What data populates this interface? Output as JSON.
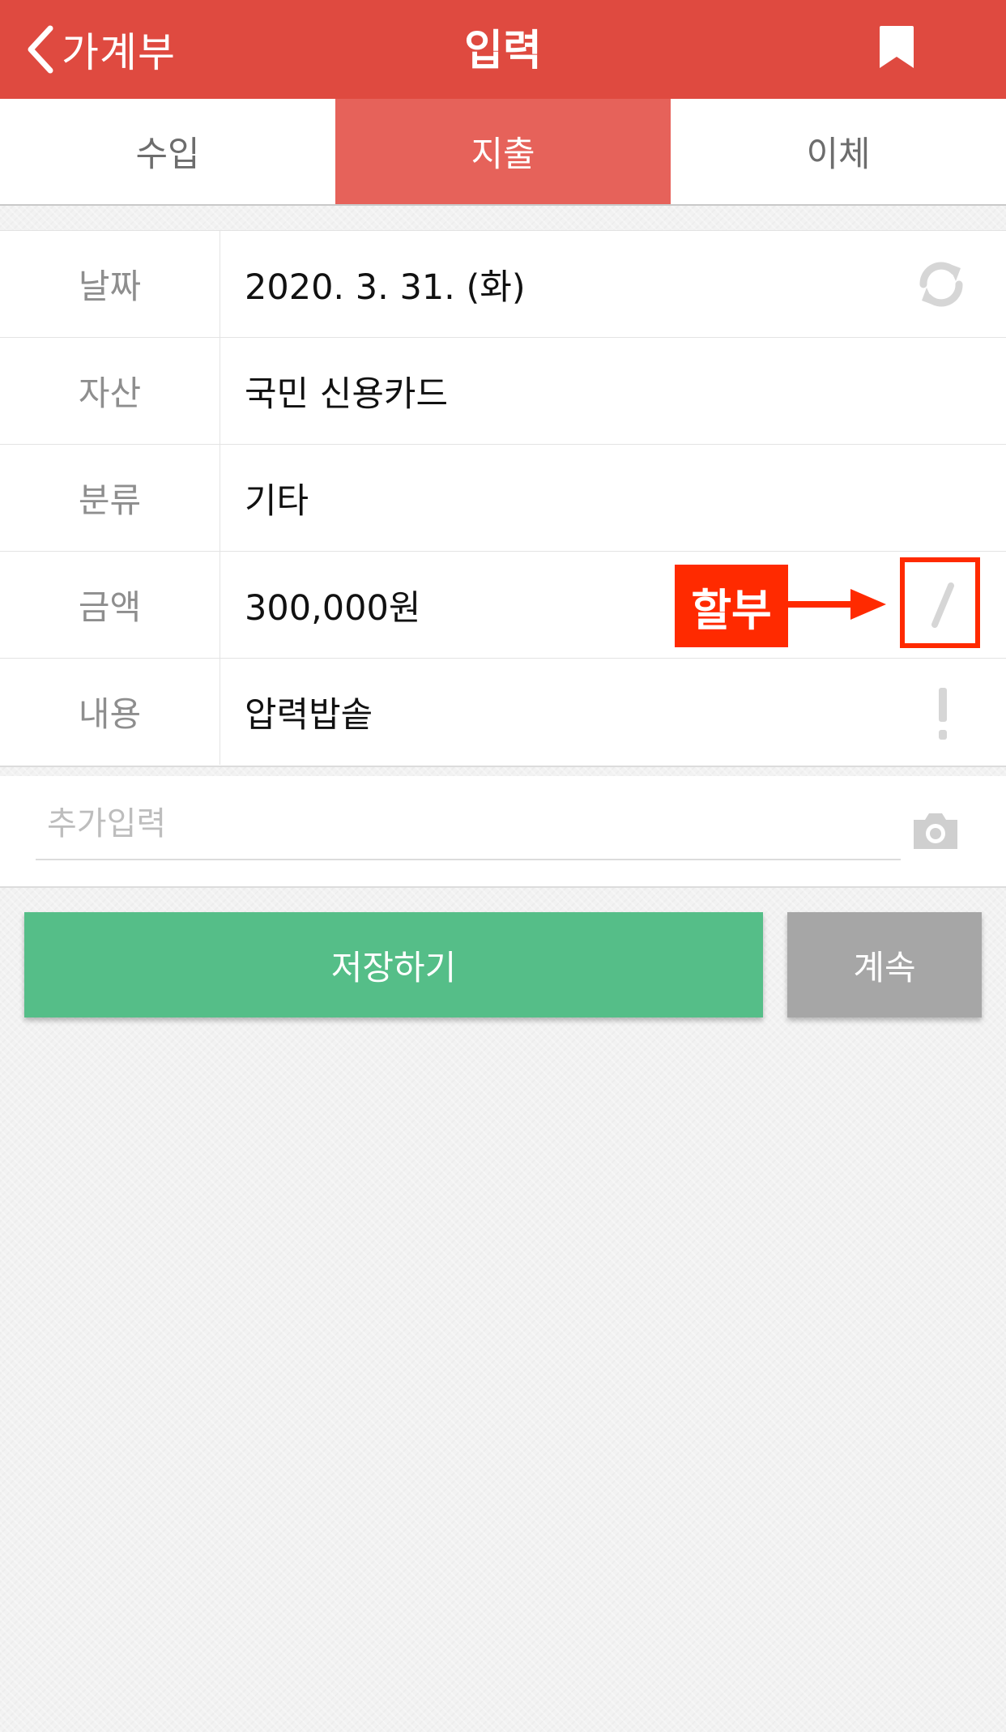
{
  "header": {
    "back_label": "가계부",
    "title": "입력"
  },
  "tabs": [
    {
      "label": "수입",
      "active": false
    },
    {
      "label": "지출",
      "active": true
    },
    {
      "label": "이체",
      "active": false
    }
  ],
  "form": {
    "date": {
      "label": "날짜",
      "value": "2020. 3. 31. (화)"
    },
    "asset": {
      "label": "자산",
      "value": "국민 신용카드"
    },
    "category": {
      "label": "분류",
      "value": "기타"
    },
    "amount": {
      "label": "금액",
      "value": "300,000원"
    },
    "memo": {
      "label": "내용",
      "value": "압력밥솥"
    }
  },
  "annotation": {
    "label": "할부",
    "color": "#ff2a00"
  },
  "extra": {
    "placeholder": "추가입력",
    "value": ""
  },
  "actions": {
    "save_label": "저장하기",
    "continue_label": "계속"
  },
  "colors": {
    "header": "#df4a40",
    "active_tab": "#e6625a",
    "save_button": "#55be88",
    "continue_button": "#a6a6a6"
  },
  "icons": [
    "chevron-left-icon",
    "bookmark-icon",
    "refresh-icon",
    "installment-icon",
    "exclamation-icon",
    "camera-icon"
  ]
}
